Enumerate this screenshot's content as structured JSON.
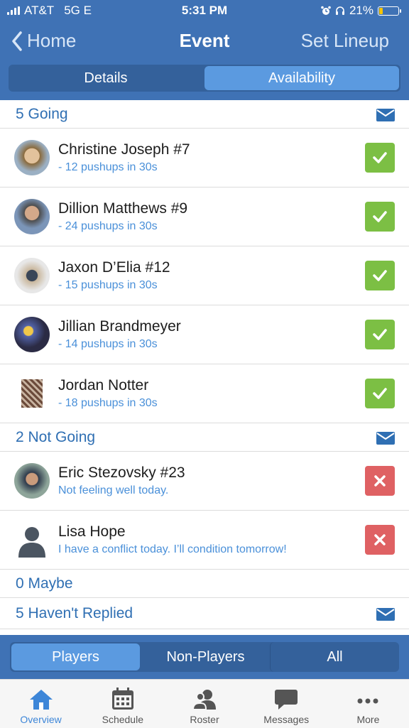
{
  "status_bar": {
    "carrier": "AT&T",
    "network": "5G E",
    "time": "5:31 PM",
    "battery": "21%",
    "battery_level": 0.21
  },
  "nav": {
    "back_label": "Home",
    "title": "Event",
    "right_label": "Set Lineup"
  },
  "tabs": [
    {
      "label": "Details",
      "active": false
    },
    {
      "label": "Availability",
      "active": true
    }
  ],
  "sections": {
    "going": {
      "label": "5 Going",
      "people": [
        {
          "name": "Christine Joseph #7",
          "note": "- 12 pushups in 30s"
        },
        {
          "name": "Dillion Matthews #9",
          "note": "- 24 pushups in 30s"
        },
        {
          "name": "Jaxon D’Elia #12",
          "note": "- 15 pushups in 30s"
        },
        {
          "name": "Jillian Brandmeyer",
          "note": "- 14 pushups in 30s"
        },
        {
          "name": "Jordan Notter",
          "note": "- 18 pushups in 30s"
        }
      ]
    },
    "not_going": {
      "label": "2 Not Going",
      "people": [
        {
          "name": "Eric Stezovsky #23",
          "note": "Not feeling well today."
        },
        {
          "name": "Lisa Hope",
          "note": "I have a conflict today. I’ll condition tomorrow!"
        }
      ]
    },
    "maybe": {
      "label": "0 Maybe"
    },
    "no_reply": {
      "label": "5 Haven't Replied"
    }
  },
  "filter_tabs": [
    {
      "label": "Players",
      "active": true
    },
    {
      "label": "Non-Players",
      "active": false
    },
    {
      "label": "All",
      "active": false
    }
  ],
  "tab_bar": [
    {
      "label": "Overview",
      "icon": "home-icon",
      "active": true
    },
    {
      "label": "Schedule",
      "icon": "calendar-icon",
      "active": false
    },
    {
      "label": "Roster",
      "icon": "people-icon",
      "active": false
    },
    {
      "label": "Messages",
      "icon": "chat-icon",
      "active": false
    },
    {
      "label": "More",
      "icon": "ellipsis-icon",
      "active": false
    }
  ],
  "colors": {
    "header": "#3f72b5",
    "accent": "#2f6fb3",
    "going": "#7cbf44",
    "not_going": "#df6163"
  }
}
